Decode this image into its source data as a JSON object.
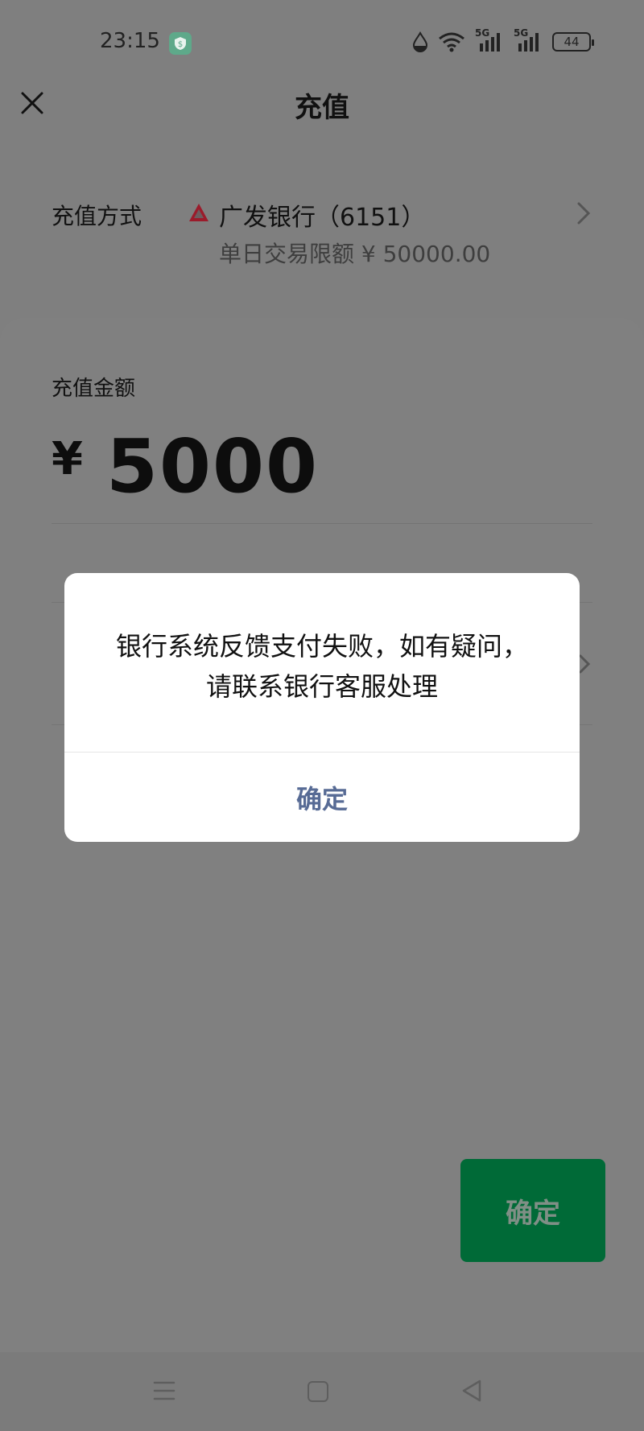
{
  "status_bar": {
    "time": "23:15",
    "app_icon": "shield-dollar-icon",
    "network_1": "5G",
    "network_2": "5G",
    "battery": "44"
  },
  "nav": {
    "title": "充值",
    "close_icon": "close-icon"
  },
  "recharge_method": {
    "label": "充值方式",
    "bank_name": "广发银行（6151）",
    "limit_text": "单日交易限额 ¥ 50000.00",
    "logo_color": "#9b1b2b"
  },
  "amount": {
    "label": "充值金额",
    "currency": "¥",
    "value": "5000"
  },
  "dialog": {
    "message": "银行系统反馈支付失败，如有疑问，请联系银行客服处理",
    "confirm_label": "确定",
    "confirm_color": "#576b95"
  },
  "main_button": {
    "label": "确定",
    "color": "#006a37"
  },
  "system_nav": {
    "menu_icon": "menu-icon",
    "home_icon": "home-icon",
    "back_icon": "back-icon"
  }
}
